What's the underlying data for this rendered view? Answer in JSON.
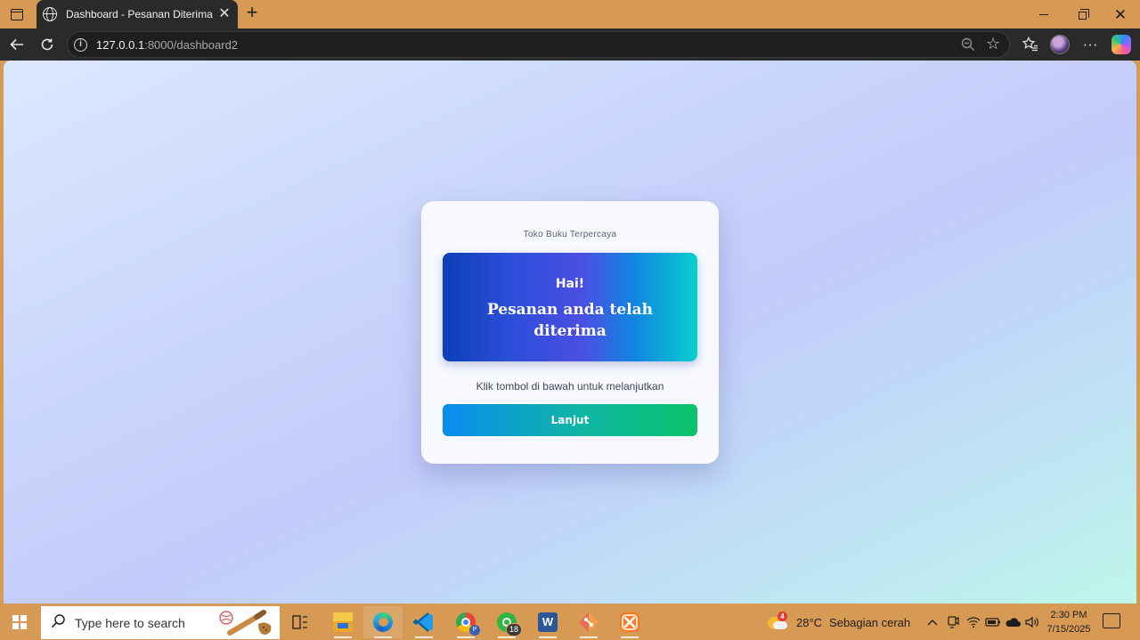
{
  "browser": {
    "tab_title": "Dashboard - Pesanan Diterima",
    "tab_close": "✕",
    "new_tab": "+",
    "url_host": "127.0.0.1",
    "url_path": ":8000/dashboard2"
  },
  "page": {
    "brand": "Toko Buku Terpercaya",
    "greeting": "Hai!",
    "message": "Pesanan anda telah diterima",
    "hint": "Klik tombol di bawah untuk melanjutkan",
    "button_label": "Lanjut",
    "colors": {
      "hero_start": "#0c3fb8",
      "hero_mid": "#4b4fe2",
      "hero_end": "#08cfd0",
      "button_start": "#0a8cf0",
      "button_end": "#0bc36a"
    }
  },
  "taskbar": {
    "search_placeholder": "Type here to search",
    "whatsapp_badge": "18",
    "weather_alert": "4",
    "temperature": "28°C",
    "weather_condition": "Sebagian cerah",
    "time": "2:30 PM",
    "date": "7/15/2025",
    "apps": [
      "task-view",
      "file-explorer",
      "edge",
      "vscode",
      "chrome",
      "whatsapp",
      "word",
      "git",
      "xampp"
    ]
  }
}
